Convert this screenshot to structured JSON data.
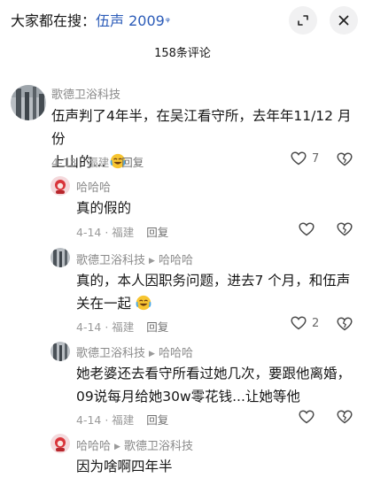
{
  "header": {
    "search_prefix": "大家都在搜：",
    "search_keyword": "伍声 2009",
    "magnifier": "ᵠ",
    "count_label": "158条评论"
  },
  "comments": [
    {
      "author": "歌德卫浴科技",
      "text_line1": "伍声判了4年半，在吴江看守所，去年年11/12 月份",
      "text_line2": "上山的...",
      "date": "4-13 · 福建",
      "reply_label": "回复",
      "likes": "7"
    },
    {
      "author": "哈哈哈",
      "text": "真的假的",
      "date": "4-14 · 福建",
      "reply_label": "回复",
      "likes": ""
    },
    {
      "author": "歌德卫浴科技",
      "reply_to": "哈哈哈",
      "text_line1": "真的，本人因职务问题，进去7 个月，和伍声",
      "text_line2": "关在一起",
      "date": "4-14 · 福建",
      "reply_label": "回复",
      "likes": "2"
    },
    {
      "author": "歌德卫浴科技",
      "reply_to": "哈哈哈",
      "text_line1": "她老婆还去看守所看过她几次，要跟他离婚，",
      "text_line2": "09说每月给她30w零花钱...让她等他",
      "date": "4-14 · 福建",
      "reply_label": "回复",
      "likes": ""
    },
    {
      "author": "哈哈哈",
      "reply_to": "歌德卫浴科技",
      "text": "因为啥啊四年半"
    }
  ],
  "colors": {
    "link": "#2b5bb8",
    "meta": "#9a9a9a"
  }
}
